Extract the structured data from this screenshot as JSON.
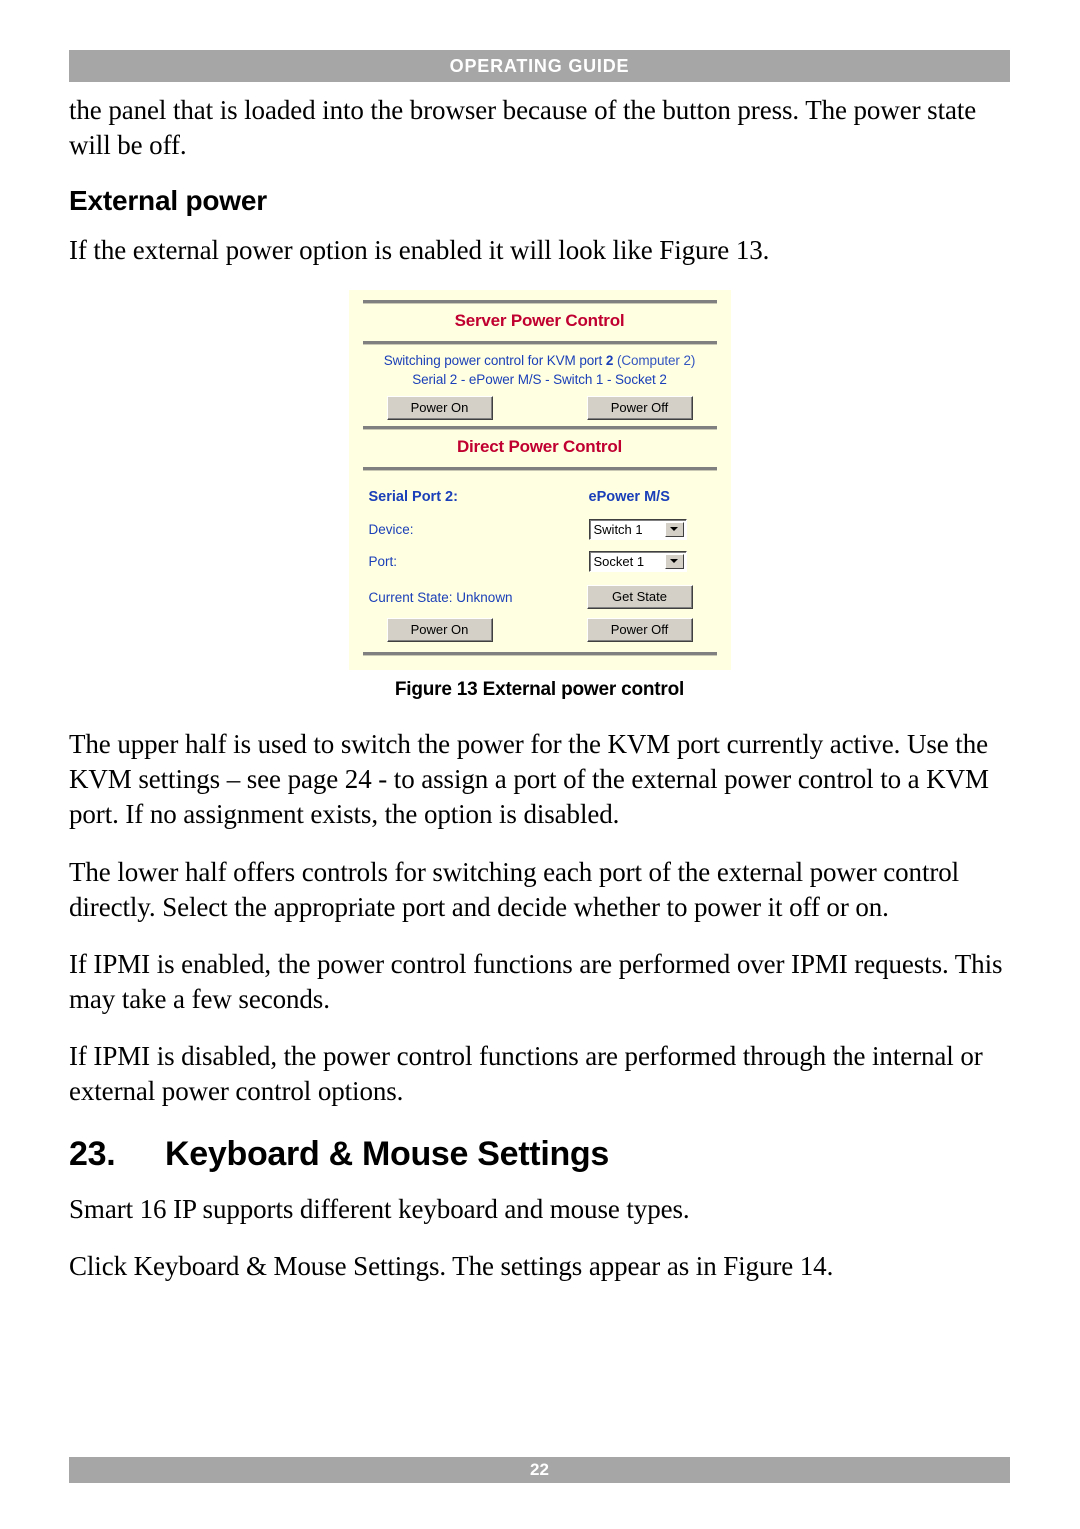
{
  "header": {
    "running_title": "OPERATING GUIDE"
  },
  "body": {
    "intro_paragraph": "the panel that is loaded into the browser because of the button press. The power state will be off.",
    "subheading": "External power",
    "figure_intro": "If the external power option is enabled it will look like Figure 13.",
    "paragraph_upper_half": "The upper half is used to switch the power for the KVM port currently active. Use the KVM settings – see page 24 - to assign a port of the external power control to a KVM port. If no assignment exists, the option is disabled.",
    "paragraph_lower_half": "The lower half offers controls for switching each port of the external power control directly. Select the appropriate port and decide whether to power it off or on.",
    "paragraph_ipmi_enabled": "If IPMI is enabled, the power control functions are performed over IPMI requests. This may take a few seconds.",
    "paragraph_ipmi_disabled": "If IPMI is disabled, the power control functions are performed through the internal or external power control options.",
    "section_number": "23.",
    "section_title": "Keyboard & Mouse Settings",
    "paragraph_smart16": "Smart 16 IP supports different keyboard and mouse types.",
    "paragraph_click_settings": "Click Keyboard & Mouse Settings. The settings appear as in Figure 14."
  },
  "figure": {
    "caption": "Figure 13 External power control",
    "server_power_control": {
      "title": "Server Power Control",
      "line1_prefix": "Switching power control for KVM port ",
      "line1_port": "2",
      "line1_suffix": " (Computer 2)",
      "line2": "Serial 2 - ePower M/S - Switch 1 - Socket 2",
      "power_on_label": "Power On",
      "power_off_label": "Power Off"
    },
    "direct_power_control": {
      "title": "Direct Power Control",
      "serial_port_label": "Serial Port 2:",
      "epower_label": "ePower M/S",
      "device_label": "Device:",
      "device_value": "Switch 1",
      "port_label": "Port:",
      "port_value": "Socket 1",
      "current_state_label": "Current State: Unknown",
      "get_state_label": "Get State",
      "power_on_label": "Power On",
      "power_off_label": "Power Off"
    },
    "colors": {
      "panel_background": "#ffffe1",
      "panel_title": "#c00030",
      "panel_text": "#1a3fb8",
      "button_face": "#d4d0c8"
    }
  },
  "footer": {
    "page_number": "22"
  }
}
